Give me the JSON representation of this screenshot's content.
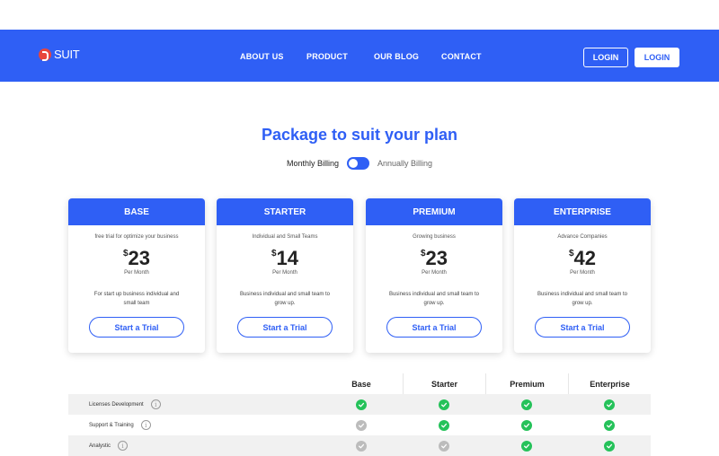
{
  "brand": {
    "name": "SUIT"
  },
  "nav": {
    "links": [
      "ABOUT US",
      "PRODUCT",
      "OUR BLOG",
      "CONTACT"
    ],
    "login_outline": "LOGIN",
    "login_solid": "LOGIN"
  },
  "pricing": {
    "title": "Package to suit your plan",
    "billing": {
      "monthly": "Monthly Billing",
      "annually": "Annually Billing",
      "selected": "Monthly Billing"
    },
    "plans": [
      {
        "name": "BASE",
        "subtitle": "free trial for optimize your business",
        "currency": "$",
        "price": "23",
        "period": "Per Month",
        "desc": "For start up business individual and small team",
        "cta": "Start a Trial"
      },
      {
        "name": "STARTER",
        "subtitle": "Individual and Small Teams",
        "currency": "$",
        "price": "14",
        "period": "Per Month",
        "desc": "Business individual and small team to grow up.",
        "cta": "Start a Trial"
      },
      {
        "name": "PREMIUM",
        "subtitle": "Growing business",
        "currency": "$",
        "price": "23",
        "period": "Per Month",
        "desc": "Business individual and small team to grow up.",
        "cta": "Start a Trial"
      },
      {
        "name": "ENTERPRISE",
        "subtitle": "Advance Companies",
        "currency": "$",
        "price": "42",
        "period": "Per Month",
        "desc": "Business individual and small team to grow up.",
        "cta": "Start a Trial"
      }
    ]
  },
  "comparison": {
    "headers": [
      "Base",
      "Starter",
      "Premium",
      "Enterprise"
    ],
    "info_glyph": "i",
    "rows": [
      {
        "feature": "Licenses Development",
        "values": [
          "green",
          "green",
          "green",
          "green"
        ]
      },
      {
        "feature": "Support & Training",
        "values": [
          "gray",
          "green",
          "green",
          "green"
        ]
      },
      {
        "feature": "Analystic",
        "values": [
          "gray",
          "gray",
          "green",
          "green"
        ]
      }
    ]
  },
  "colors": {
    "primary": "#2f5ff5",
    "check_on": "#25c25a",
    "check_off": "#bcbcbc",
    "logo": "#e8453c"
  }
}
